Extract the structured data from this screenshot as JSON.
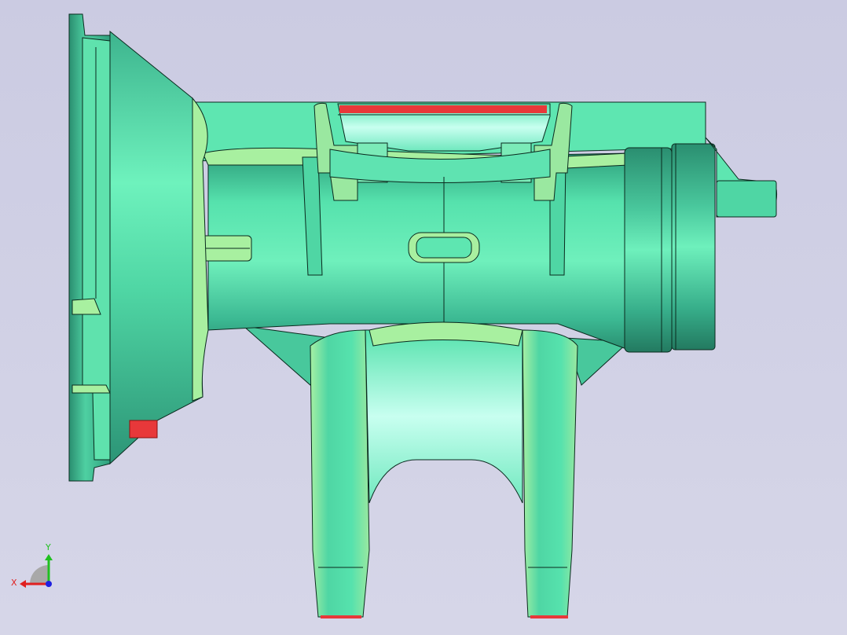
{
  "viewport": {
    "background_top": "#cbcbe2",
    "background_bottom": "#d6d6e8"
  },
  "model": {
    "part_color_dark": "#2e9e7c",
    "part_color_mid": "#56e2ad",
    "part_color_light": "#b8ffd6",
    "edge_color": "#0a2a1e",
    "fillet_color": "#a8f0a0",
    "highlight_color": "#e8383a"
  },
  "triad": {
    "x_label": "X",
    "y_label": "Y",
    "x_color": "#e02020",
    "y_color": "#20c020",
    "z_color": "#2020e0"
  }
}
